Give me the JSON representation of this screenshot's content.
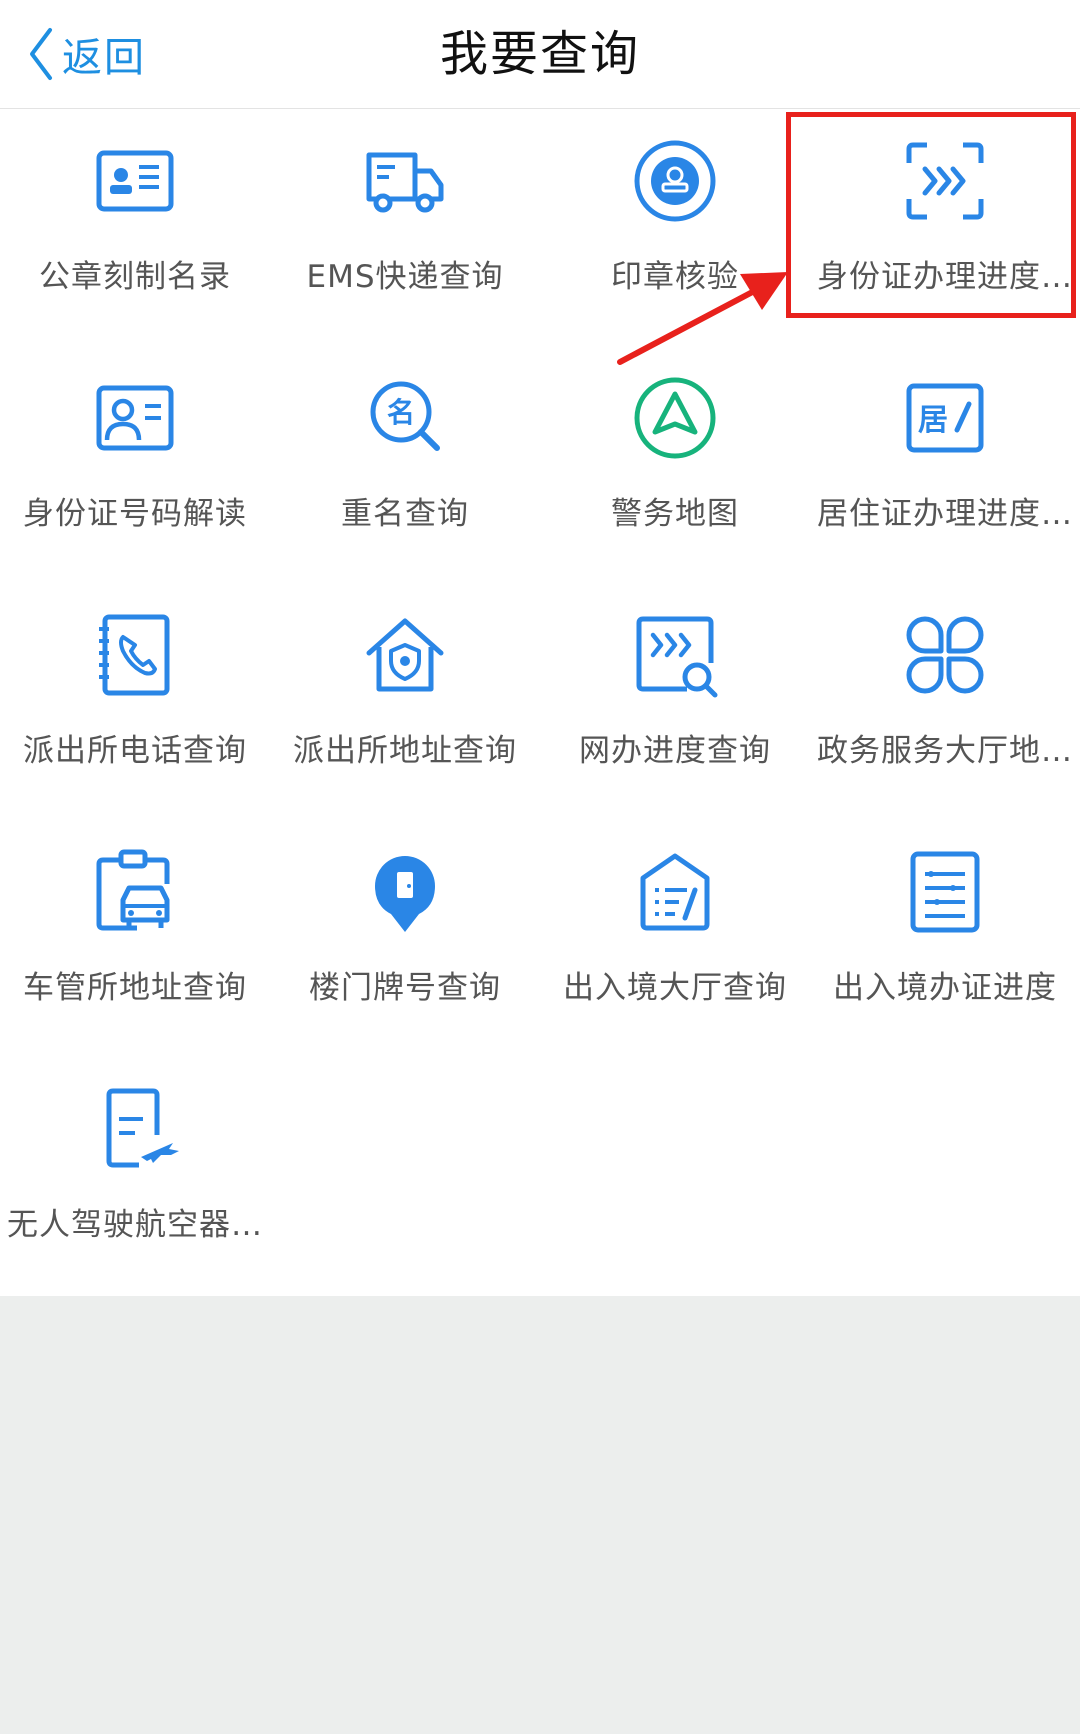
{
  "header": {
    "back_label": "返回",
    "title": "我要查询"
  },
  "colors": {
    "accent": "#1e8fe1",
    "icon_blue": "#2a86e6",
    "icon_green": "#17b37c",
    "highlight_red": "#e8211c"
  },
  "items": [
    {
      "label": "公章刻制名录",
      "icon": "id-card-icon"
    },
    {
      "label": "EMS快递查询",
      "icon": "truck-icon"
    },
    {
      "label": "印章核验",
      "icon": "stamp-icon"
    },
    {
      "label": "身份证办理进度…",
      "icon": "scan-progress-icon",
      "highlighted": true
    },
    {
      "label": "身份证号码解读",
      "icon": "profile-card-icon"
    },
    {
      "label": "重名查询",
      "icon": "name-search-icon"
    },
    {
      "label": "警务地图",
      "icon": "map-navigation-icon"
    },
    {
      "label": "居住证办理进度…",
      "icon": "residence-card-icon"
    },
    {
      "label": "派出所电话查询",
      "icon": "phone-book-icon"
    },
    {
      "label": "派出所地址查询",
      "icon": "police-house-icon"
    },
    {
      "label": "网办进度查询",
      "icon": "online-progress-icon"
    },
    {
      "label": "政务服务大厅地…",
      "icon": "clover-icon"
    },
    {
      "label": "车管所地址查询",
      "icon": "vehicle-clipboard-icon"
    },
    {
      "label": "楼门牌号查询",
      "icon": "location-pin-icon"
    },
    {
      "label": "出入境大厅查询",
      "icon": "document-house-icon"
    },
    {
      "label": "出入境办证进度",
      "icon": "checklist-icon"
    },
    {
      "label": "无人驾驶航空器…",
      "icon": "drone-document-icon"
    }
  ]
}
